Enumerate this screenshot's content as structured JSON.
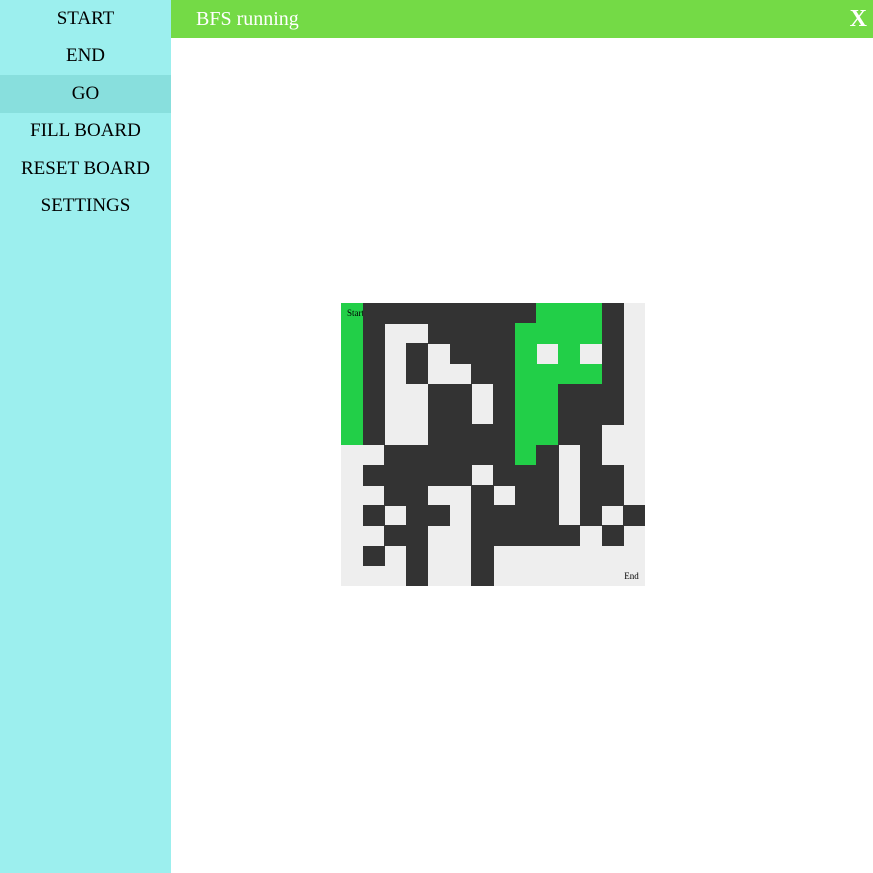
{
  "sidebar": {
    "items": [
      {
        "label": "START",
        "name": "menu-start"
      },
      {
        "label": "END",
        "name": "menu-end"
      },
      {
        "label": "GO",
        "name": "menu-go",
        "active": true
      },
      {
        "label": "FILL BOARD",
        "name": "menu-fill-board"
      },
      {
        "label": "RESET BOARD",
        "name": "menu-reset-board"
      },
      {
        "label": "SETTINGS",
        "name": "menu-settings"
      }
    ]
  },
  "status": {
    "text": "BFS running",
    "close_label": "X"
  },
  "board": {
    "start_label": "Start",
    "end_label": "End",
    "grid": [
      "SWWWWWWWWPPPW.",
      "PW..WWWWPPPPW.",
      "PW.W.WWWP.P.W.",
      "PW.W..WWPPPPW.",
      "PW..WW.WPPWWW.",
      "PW..WW.WPPWWW.",
      "PW..WWWWPPWW..",
      "..WWWWWWPW.W..",
      ".WWWWW.WWW.WW.",
      "..WW..W.WW.WW.",
      ".W.WW.WWWW.W.W",
      "..WW..WWWWW.W.",
      ".W.W..W.......",
      "...W..W......E"
    ]
  },
  "colors": {
    "sidebar_bg": "#9cefee",
    "active_item_bg": "#88dfdd",
    "status_bg": "#74da46",
    "wall": "#333333",
    "empty": "#eeeeee",
    "path": "#22cf48"
  }
}
